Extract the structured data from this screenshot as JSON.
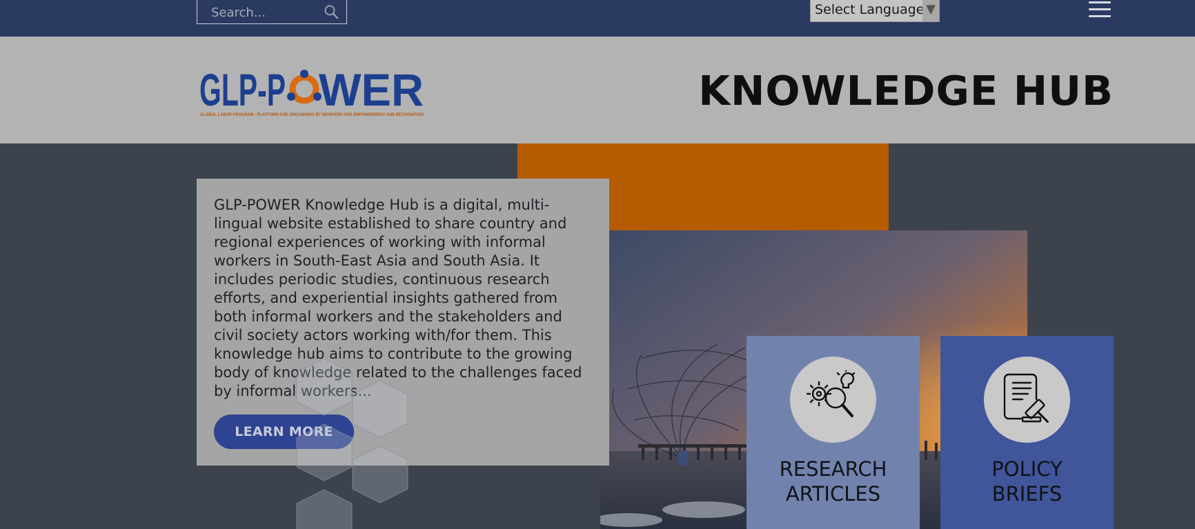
{
  "topbar": {
    "search_placeholder": "Search...",
    "language_label": "Select Language",
    "language_arrow": "▼"
  },
  "header": {
    "logo_text": "GLP-POWER",
    "logo_tagline": "GLOBAL LABOR PROGRAM - PLATFORM FOR ORGANISING BY WORKERS FOR EMPOWERMENT AND RECOGNITION",
    "page_title": "KNOWLEDGE HUB"
  },
  "intro": {
    "text": "GLP-POWER Knowledge Hub is a digital, multi-lingual website established to share country and regional experiences of working with informal workers in South-East Asia and South Asia. It includes periodic studies, continuous research efforts, and experiential insights gathered from both informal workers and the stakeholders and civil society actors working with/for them. This knowledge hub aims to contribute to the growing body of knowledge related to the challenges faced by informal workers...",
    "button_label": "LEARN MORE"
  },
  "tiles": [
    {
      "line1": "RESEARCH",
      "line2": "ARTICLES",
      "icon": "research-gear-magnifier-icon"
    },
    {
      "line1": "POLICY",
      "line2": "BRIEFS",
      "icon": "document-gavel-icon"
    }
  ],
  "colors": {
    "topbar": "#2b3a61",
    "header": "#b3b3b3",
    "accent_orange": "#b55c00",
    "button_blue": "#2e4391",
    "tile_research": "#7183ad",
    "tile_policy": "#40559a"
  }
}
